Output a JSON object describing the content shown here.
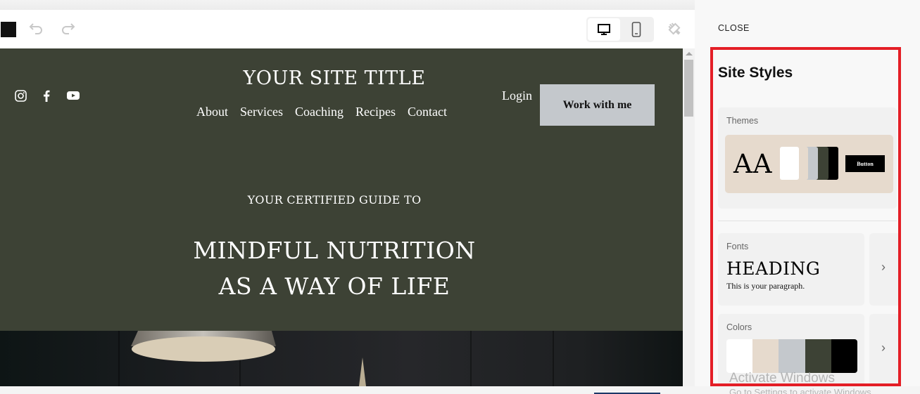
{
  "toolbar": {
    "undo_icon": "undo-icon",
    "redo_icon": "redo-icon",
    "desktop_icon": "desktop-icon",
    "mobile_icon": "mobile-icon",
    "style_brush_icon": "paint-brush-icon",
    "active_device": "desktop"
  },
  "site": {
    "title": "YOUR SITE TITLE",
    "social": [
      "instagram-icon",
      "facebook-icon",
      "youtube-icon"
    ],
    "nav": [
      "About",
      "Services",
      "Coaching",
      "Recipes",
      "Contact"
    ],
    "login": "Login",
    "cta": "Work with me",
    "kicker": "YOUR CERTIFIED GUIDE TO",
    "headline_line1": "MINDFUL NUTRITION",
    "headline_line2": "AS A WAY OF LIFE",
    "colors": {
      "hero_bg": "#3d4235",
      "cta_bg": "#c4c8cc"
    }
  },
  "panel": {
    "close": "CLOSE",
    "title": "Site Styles",
    "themes": {
      "label": "Themes",
      "sample": "AA",
      "button_label": "Button",
      "swatches": [
        "#ffffff",
        "#e6dacd",
        "#c4c8cc",
        "#3d4235",
        "#000000"
      ]
    },
    "fonts": {
      "label": "Fonts",
      "heading": "HEADING",
      "paragraph": "This is your paragraph."
    },
    "colors": {
      "label": "Colors",
      "swatches": [
        "#ffffff",
        "#e6dacd",
        "#c4c8cc",
        "#3d4235",
        "#000000"
      ]
    },
    "chevron": "›"
  },
  "watermark": {
    "line1": "Activate Windows",
    "line2": "Go to Settings to activate Windows."
  }
}
